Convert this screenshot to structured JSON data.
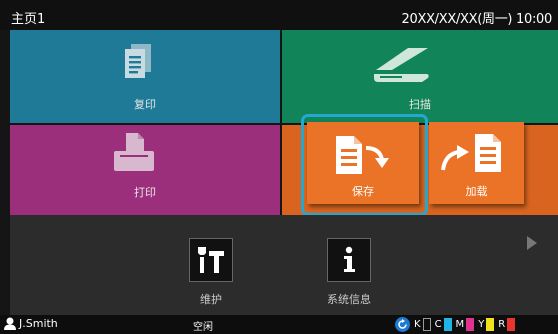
{
  "header": {
    "title": "主页1",
    "datetime": "20XX/XX/XX(周一) 10:00"
  },
  "tiles": {
    "copy": "复印",
    "scan": "扫描",
    "print": "打印",
    "save": "保存",
    "load": "加载"
  },
  "tools": {
    "maintenance": "维护",
    "system_info": "系统信息"
  },
  "status": {
    "user": "J.Smith",
    "state": "空闲",
    "ink": [
      {
        "label": "K",
        "color": "#111111"
      },
      {
        "label": "C",
        "color": "#1fb6e6"
      },
      {
        "label": "M",
        "color": "#e0338f"
      },
      {
        "label": "Y",
        "color": "#f2e21c"
      },
      {
        "label": "R",
        "color": "#e8332e"
      }
    ]
  },
  "colors": {
    "copy": "#1e7a96",
    "scan": "#12845a",
    "print": "#9b2f7c",
    "store": "#d8641f",
    "focus": "#24a7d1"
  },
  "icons": {
    "copy": "document-stack-icon",
    "scan": "scanner-icon",
    "print": "printer-icon",
    "save": "document-arrow-down-icon",
    "load": "arrow-document-icon",
    "maintenance": "tools-icon",
    "system_info": "info-icon",
    "next": "chevron-right-icon"
  }
}
